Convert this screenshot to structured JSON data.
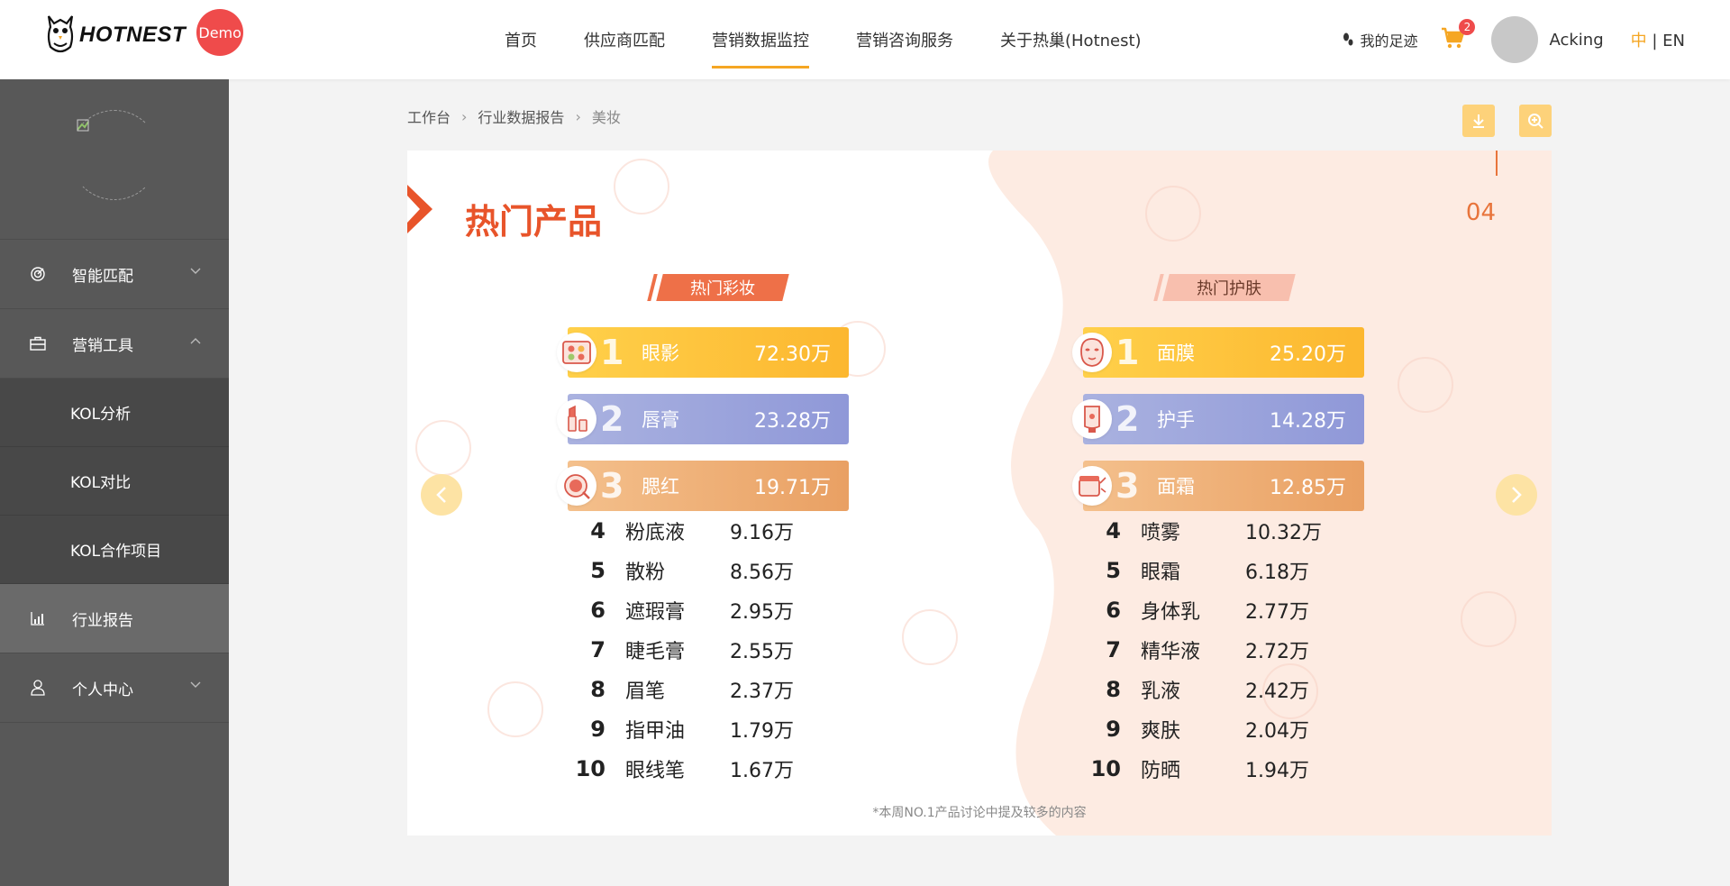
{
  "header": {
    "logo_text": "HOTNEST",
    "demo_badge": "Demo",
    "nav": [
      "首页",
      "供应商匹配",
      "营销数据监控",
      "营销咨询服务",
      "关于热巢(Hotnest)"
    ],
    "active_nav_index": 2,
    "footprint_label": "我的足迹",
    "cart_count": "2",
    "username": "Acking",
    "lang_cn": "中",
    "lang_sep": " | ",
    "lang_en": "EN"
  },
  "sidebar": {
    "items": [
      {
        "label": "智能匹配",
        "icon": "target-icon",
        "expanded": false
      },
      {
        "label": "营销工具",
        "icon": "briefcase-icon",
        "expanded": true
      },
      {
        "label": "KOL分析"
      },
      {
        "label": "KOL对比"
      },
      {
        "label": "KOL合作项目"
      },
      {
        "label": "行业报告",
        "icon": "chart-icon",
        "selected": true
      },
      {
        "label": "个人中心",
        "icon": "user-icon",
        "expanded": false
      }
    ]
  },
  "breadcrumb": [
    "工作台",
    "行业数据报告",
    "美妆"
  ],
  "card": {
    "title": "热门产品",
    "page_number": "04",
    "makeup": {
      "tag": "热门彩妆",
      "top3": [
        {
          "rank": "1",
          "name": "眼影",
          "value": "72.30万"
        },
        {
          "rank": "2",
          "name": "唇膏",
          "value": "23.28万"
        },
        {
          "rank": "3",
          "name": "腮红",
          "value": "19.71万"
        }
      ],
      "rest": [
        {
          "rank": "4",
          "name": "粉底液",
          "value": "9.16万"
        },
        {
          "rank": "5",
          "name": "散粉",
          "value": "8.56万"
        },
        {
          "rank": "6",
          "name": "遮瑕膏",
          "value": "2.95万"
        },
        {
          "rank": "7",
          "name": "睫毛膏",
          "value": "2.55万"
        },
        {
          "rank": "8",
          "name": "眉笔",
          "value": "2.37万"
        },
        {
          "rank": "9",
          "name": "指甲油",
          "value": "1.79万"
        },
        {
          "rank": "10",
          "name": "眼线笔",
          "value": "1.67万"
        }
      ]
    },
    "skincare": {
      "tag": "热门护肤",
      "top3": [
        {
          "rank": "1",
          "name": "面膜",
          "value": "25.20万"
        },
        {
          "rank": "2",
          "name": "护手",
          "value": "14.28万"
        },
        {
          "rank": "3",
          "name": "面霜",
          "value": "12.85万"
        }
      ],
      "rest": [
        {
          "rank": "4",
          "name": "喷雾",
          "value": "10.32万"
        },
        {
          "rank": "5",
          "name": "眼霜",
          "value": "6.18万"
        },
        {
          "rank": "6",
          "name": "身体乳",
          "value": "2.77万"
        },
        {
          "rank": "7",
          "name": "精华液",
          "value": "2.72万"
        },
        {
          "rank": "8",
          "name": "乳液",
          "value": "2.42万"
        },
        {
          "rank": "9",
          "name": "爽肤",
          "value": "2.04万"
        },
        {
          "rank": "10",
          "name": "防晒",
          "value": "1.94万"
        }
      ]
    },
    "footnote": "*本周NO.1产品讨论中提及较多的内容"
  },
  "colors": {
    "accent": "#f5a623",
    "title": "#e8542a",
    "sidebar": "#585858",
    "badge": "#ef4b4b"
  }
}
